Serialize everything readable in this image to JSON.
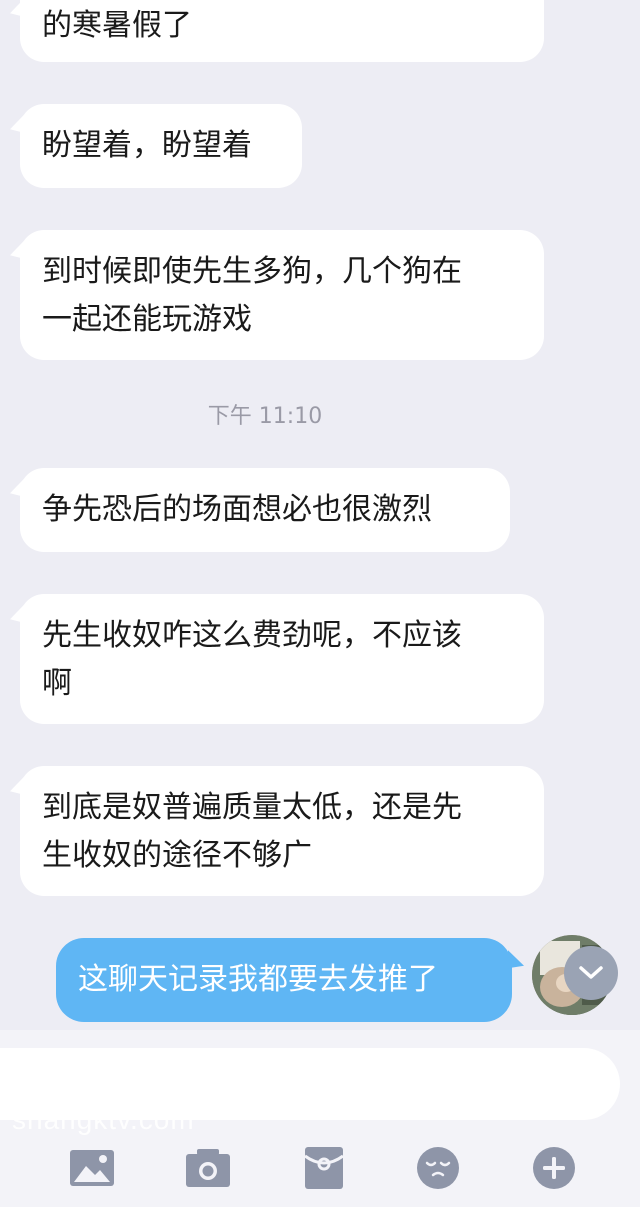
{
  "messages": [
    {
      "side": "in",
      "text_lines": [
        "的寒暑假了"
      ]
    },
    {
      "side": "in",
      "text_lines": [
        "盼望着，盼望着"
      ]
    },
    {
      "side": "in",
      "text_lines": [
        "到时候即使先生多狗，几个狗在",
        "一起还能玩游戏"
      ]
    },
    {
      "side": "in",
      "text_lines": [
        "争先恐后的场面想必也很激烈"
      ]
    },
    {
      "side": "in",
      "text_lines": [
        "先生收奴咋这么费劲呢，不应该",
        "啊"
      ]
    },
    {
      "side": "in",
      "text_lines": [
        "到底是奴普遍质量太低，还是先",
        "生收奴的途径不够广"
      ]
    },
    {
      "side": "out",
      "text_lines": [
        "这聊天记录我都要去发推了"
      ]
    }
  ],
  "timestamp": "下午 11:10",
  "watermark": "shangktv.com",
  "input": {
    "value": ""
  },
  "toolbar": {
    "items": [
      {
        "icon": "image-icon"
      },
      {
        "icon": "camera-icon"
      },
      {
        "icon": "red-packet-icon"
      },
      {
        "icon": "emoji-icon"
      },
      {
        "icon": "plus-icon"
      }
    ]
  },
  "colors": {
    "background": "#ededf4",
    "incoming_bubble": "#ffffff",
    "outgoing_bubble": "#5fb6f4",
    "toolbar_icon": "#8e95a8"
  }
}
